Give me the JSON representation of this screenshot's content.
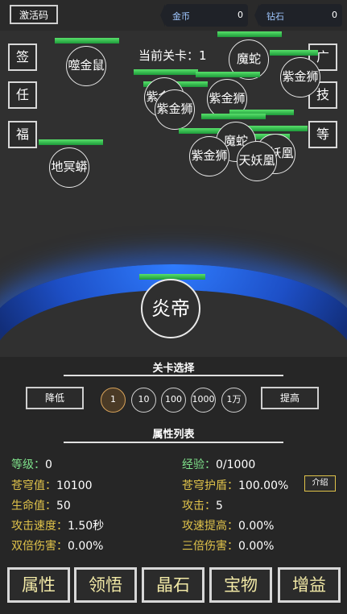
{
  "top": {
    "code_btn": "激活码",
    "gold_label": "金币",
    "gold_value": "0",
    "diamond_label": "钻石",
    "diamond_value": "0"
  },
  "side_left": [
    "签",
    "任",
    "福"
  ],
  "side_right": [
    "广",
    "技",
    "等"
  ],
  "stage": {
    "label": "当前关卡：1"
  },
  "enemies": [
    "噬金鼠",
    "魔蛇",
    "紫金狮",
    "紫金狮",
    "紫金狮",
    "紫金狮",
    "紫金狮",
    "地冥蟒",
    "魔蛇",
    "天妖凰",
    "天妖凰",
    "紫金狮"
  ],
  "hero": "炎帝",
  "level_select": {
    "title": "关卡选择",
    "decrease": "降低",
    "increase": "提高",
    "steps": [
      "1",
      "10",
      "100",
      "1000",
      "1万"
    ]
  },
  "attributes": {
    "title": "属性列表",
    "intro_btn": "介绍",
    "left": [
      {
        "k": "等级：",
        "v": "0"
      },
      {
        "k": "苍穹值：",
        "v": "10100"
      },
      {
        "k": "生命值：",
        "v": "50"
      },
      {
        "k": "攻击速度：",
        "v": "1.50秒"
      },
      {
        "k": "双倍伤害：",
        "v": "0.00%"
      }
    ],
    "right": [
      {
        "k": "经验：",
        "v": "0/1000"
      },
      {
        "k": "苍穹护盾：",
        "v": "100.00%"
      },
      {
        "k": "攻击：",
        "v": "5"
      },
      {
        "k": "攻速提高：",
        "v": "0.00%"
      },
      {
        "k": "三倍伤害：",
        "v": "0.00%"
      }
    ]
  },
  "tabs": [
    "属性",
    "领悟",
    "晶石",
    "宝物",
    "增益"
  ],
  "colors": {
    "hp_bar": "#3cc655",
    "arc_glow": "#2f7cff",
    "attr_key": "#e0c34a",
    "attr_key_green": "#7ee08a"
  }
}
